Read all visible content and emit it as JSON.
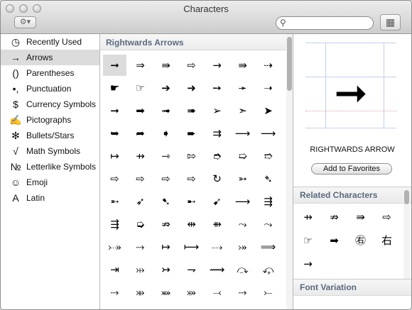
{
  "window": {
    "title": "Characters"
  },
  "toolbar": {
    "action_glyph": "⚙▾",
    "grid_glyph": "▦",
    "search_placeholder": ""
  },
  "sidebar": {
    "items": [
      {
        "icon": "◷",
        "icon_name": "clock-icon",
        "label": "Recently Used"
      },
      {
        "icon": "→",
        "icon_name": "arrow-icon",
        "label": "Arrows",
        "selected": true
      },
      {
        "icon": "()",
        "icon_name": "parentheses-icon",
        "label": "Parentheses"
      },
      {
        "icon": "•,",
        "icon_name": "punctuation-icon",
        "label": "Punctuation"
      },
      {
        "icon": "$",
        "icon_name": "dollar-icon",
        "label": "Currency Symbols"
      },
      {
        "icon": "✍",
        "icon_name": "pictograph-icon",
        "label": "Pictographs"
      },
      {
        "icon": "✻",
        "icon_name": "asterisk-icon",
        "label": "Bullets/Stars"
      },
      {
        "icon": "√",
        "icon_name": "sqrt-icon",
        "label": "Math Symbols"
      },
      {
        "icon": "№",
        "icon_name": "numero-icon",
        "label": "Letterlike Symbols"
      },
      {
        "icon": "☺",
        "icon_name": "smiley-icon",
        "label": "Emoji"
      },
      {
        "icon": "A",
        "icon_name": "letter-a-icon",
        "label": "Latin"
      }
    ]
  },
  "main": {
    "title": "Rightwards Arrows",
    "rows": [
      [
        "➞",
        "⇒",
        "⇛",
        "⇨",
        "→",
        "⇛",
        "⇢"
      ],
      [
        "☛",
        "☞",
        "➔",
        "➜",
        "➙",
        "➛",
        "➝"
      ],
      [
        "➞",
        "➡",
        "➟",
        "➠",
        "➢",
        "➣",
        "➤"
      ],
      [
        "➥",
        "➦",
        "➧",
        "➨",
        "⇉",
        "⟶",
        "⟶"
      ],
      [
        "↦",
        "⇸",
        "⇾",
        "⇰",
        "➮",
        "➯",
        "➱"
      ],
      [
        "⇨",
        "⇨",
        "⇨",
        "⇨",
        "↻",
        "➳",
        "➴"
      ],
      [
        "➵",
        "➶",
        "➷",
        "➸",
        "➹",
        "⟶",
        "⇶"
      ],
      [
        "⇶",
        "➭",
        "⇏",
        "⇹",
        "⇻",
        "⤳",
        "⤳"
      ],
      [
        "⤐",
        "⤑",
        "↦",
        "⟼",
        "⤏",
        "⤖",
        "⟹"
      ],
      [
        "⇥",
        "⤔",
        "↣",
        "⇁",
        "⟿",
        "⤼",
        "⤽"
      ],
      [
        "⤑",
        "⤕",
        "⤘",
        "⤗",
        "⤙",
        "⤑",
        "⤚"
      ]
    ]
  },
  "detail": {
    "preview_glyph": "➞",
    "name": "RIGHTWARDS ARROW",
    "favorites_button": "Add to Favorites",
    "related_title": "Related Characters",
    "related": [
      "⇸",
      "⇏",
      "⇛",
      "⇨",
      "☞",
      "➡",
      "㊨",
      "右",
      "→"
    ],
    "font_variation_title": "Font Variation"
  }
}
